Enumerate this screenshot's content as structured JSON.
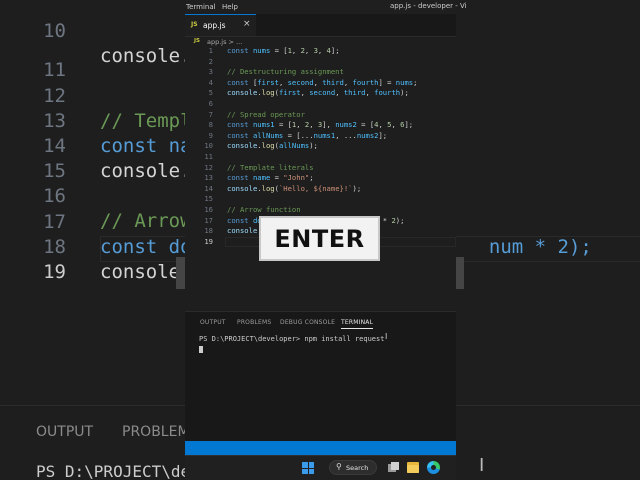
{
  "window": {
    "menu": [
      "Terminal",
      "Help"
    ],
    "title": "app.js - developer - Vi"
  },
  "tabs": [
    {
      "label": "app.js",
      "icon": "js-icon",
      "close": "×"
    }
  ],
  "breadcrumbs": "app.js > ...",
  "editor": {
    "line_numbers": [
      "1",
      "2",
      "3",
      "4",
      "5",
      "6",
      "7",
      "8",
      "9",
      "10",
      "11",
      "12",
      "13",
      "14",
      "15",
      "16",
      "17",
      "18",
      "19"
    ],
    "lines": [
      "const nums = [1, 2, 3, 4];",
      "",
      "// Destructuring assignment",
      "const [first, second, third, fourth] = nums;",
      "console.log(first, second, third, fourth);",
      "",
      "// Spread operator",
      "const nums1 = [1, 2, 3], nums2 = [4, 5, 6];",
      "const allNums = [...nums1, ...nums2];",
      "console.log(allNums);",
      "",
      "// Template literals",
      "const name = \"John\";",
      "console.log(`Hello, ${name}!`);",
      "",
      "// Arrow function",
      "const do                        num * 2);",
      "console.l",
      ""
    ]
  },
  "background_zoom": {
    "line_numbers": [
      "10",
      "11",
      "12",
      "13",
      "14",
      "15",
      "16",
      "17",
      "18",
      "19"
    ],
    "lines": [
      "console.l",
      "",
      "// Templa",
      "const nam",
      "console.l",
      "",
      "// Arrow",
      "const do                          num * 2);",
      "console.l",
      ""
    ],
    "panel_tabs": [
      "OUTPUT",
      "PROBLEM"
    ],
    "terminal": "PS D:\\PROJECT\\de"
  },
  "panel": {
    "tabs": [
      "OUTPUT",
      "PROBLEMS",
      "DEBUG CONSOLE",
      "TERMINAL"
    ],
    "active_tab": "TERMINAL",
    "terminal_line": "PS D:\\PROJECT\\developer> npm install request"
  },
  "taskbar": {
    "search_label": "Search"
  },
  "overlay": {
    "key_label": "ENTER"
  },
  "colors": {
    "accent": "#0078d4",
    "keyword": "#569cd6",
    "comment": "#6a9955",
    "string": "#ce9178",
    "number": "#b5cea8"
  }
}
